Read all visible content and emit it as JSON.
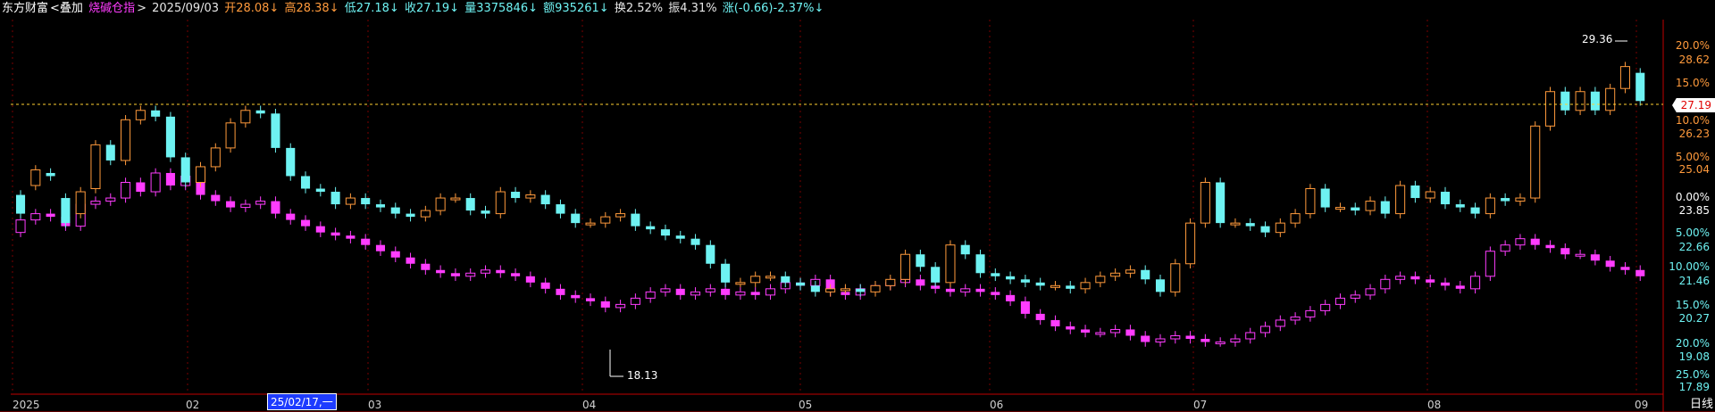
{
  "header": {
    "stock": "东方财富",
    "overlay_label": "<叠加",
    "overlay_name": "烧碱仓指",
    "arrow": ">",
    "date": "2025/09/03",
    "open": "开28.08↓",
    "high": "高28.38↓",
    "low": "低27.18↓",
    "close": "收27.19↓",
    "volume": "量3375846↓",
    "amount": "额935261↓",
    "turnover": "换2.52%",
    "amplitude": "振4.31%",
    "change": "涨(-0.66)-2.37%↓"
  },
  "right_axis": [
    {
      "text": "20.0%",
      "color": "#ff9a3c"
    },
    {
      "text": "28.62",
      "color": "#ff9a3c"
    },
    {
      "text": "15.0%",
      "color": "#ff9a3c"
    },
    {
      "text": "10.0%",
      "color": "#ff9a3c"
    },
    {
      "text": "26.23",
      "color": "#ff9a3c"
    },
    {
      "text": "5.00%",
      "color": "#ff9a3c"
    },
    {
      "text": "25.04",
      "color": "#ff9a3c"
    },
    {
      "text": "0.00%",
      "color": "#ffffff"
    },
    {
      "text": "23.85",
      "color": "#ffffff"
    },
    {
      "text": "5.00%",
      "color": "#6ef2f2"
    },
    {
      "text": "22.66",
      "color": "#6ef2f2"
    },
    {
      "text": "10.00%",
      "color": "#6ef2f2"
    },
    {
      "text": "21.46",
      "color": "#6ef2f2"
    },
    {
      "text": "15.0%",
      "color": "#6ef2f2"
    },
    {
      "text": "20.27",
      "color": "#6ef2f2"
    },
    {
      "text": "20.0%",
      "color": "#6ef2f2"
    },
    {
      "text": "19.08",
      "color": "#6ef2f2"
    },
    {
      "text": "25.0%",
      "color": "#6ef2f2"
    },
    {
      "text": "17.89",
      "color": "#6ef2f2"
    }
  ],
  "last_price": "27.19",
  "annotations": {
    "high_label": "29.36",
    "low_label": "18.13"
  },
  "months": [
    "2025",
    "02",
    "03",
    "04",
    "05",
    "06",
    "07",
    "08",
    "09"
  ],
  "cursor_date": "25/02/17,一",
  "period": "日线",
  "colors": {
    "up": "#ff3cff",
    "down": "#6ef2f2",
    "overlay_up": "#ff9a3c",
    "grid": "#7a0000",
    "axis": "#c00000"
  },
  "chart_data": {
    "type": "candlestick",
    "y_range": [
      17.89,
      29.8
    ],
    "series": [
      {
        "name": "东方财富",
        "role": "main",
        "closes": [
          23.6,
          25.0,
          24.8,
          23.3,
          24.3,
          25.8,
          25.3,
          26.6,
          26.9,
          26.7,
          25.4,
          24.6,
          25.1,
          25.7,
          26.5,
          26.9,
          26.8,
          25.7,
          24.8,
          24.4,
          24.3,
          23.9,
          24.1,
          23.9,
          23.8,
          23.6,
          23.5,
          23.7,
          24.1,
          24.1,
          23.7,
          23.6,
          24.3,
          24.1,
          24.2,
          23.9,
          23.6,
          23.3,
          23.3,
          23.5,
          23.6,
          23.2,
          23.1,
          22.9,
          22.8,
          22.6,
          22.0,
          21.4,
          21.4,
          21.6,
          21.6,
          21.4,
          21.3,
          21.1,
          21.2,
          21.2,
          21.1,
          21.3,
          21.5,
          22.3,
          21.9,
          21.4,
          22.6,
          22.3,
          21.7,
          21.6,
          21.5,
          21.4,
          21.3,
          21.3,
          21.2,
          21.4,
          21.6,
          21.7,
          21.8,
          21.5,
          21.1,
          22.0,
          23.3,
          24.6,
          23.3,
          23.3,
          23.2,
          23.0,
          23.3,
          23.6,
          24.4,
          23.8,
          23.8,
          23.7,
          24.0,
          23.6,
          24.5,
          24.1,
          24.3,
          23.9,
          23.8,
          23.6,
          24.1,
          24.0,
          24.1,
          26.4,
          27.5,
          26.9,
          27.5,
          26.9,
          27.6,
          28.3,
          27.2
        ],
        "opens": [
          24.2,
          24.5,
          24.9,
          24.1,
          23.6,
          24.4,
          25.8,
          25.3,
          26.6,
          26.9,
          26.7,
          25.4,
          24.6,
          25.1,
          25.7,
          26.5,
          26.9,
          26.8,
          25.7,
          24.8,
          24.4,
          24.3,
          23.9,
          24.1,
          23.9,
          23.8,
          23.6,
          23.5,
          23.7,
          24.1,
          24.1,
          23.7,
          23.6,
          24.3,
          24.1,
          24.2,
          23.9,
          23.6,
          23.3,
          23.3,
          23.5,
          23.6,
          23.2,
          23.1,
          22.9,
          22.8,
          22.6,
          22.0,
          21.4,
          21.4,
          21.6,
          21.6,
          21.4,
          21.3,
          21.1,
          21.2,
          21.2,
          21.1,
          21.3,
          21.5,
          22.3,
          21.9,
          21.4,
          22.6,
          22.3,
          21.7,
          21.6,
          21.5,
          21.4,
          21.3,
          21.3,
          21.2,
          21.4,
          21.6,
          21.7,
          21.8,
          21.5,
          21.1,
          22.0,
          23.3,
          24.6,
          23.3,
          23.3,
          23.2,
          23.0,
          23.3,
          23.6,
          24.4,
          23.8,
          23.8,
          23.7,
          24.0,
          23.6,
          24.5,
          24.1,
          24.3,
          23.9,
          23.8,
          23.6,
          24.1,
          24.0,
          24.1,
          26.4,
          27.5,
          26.9,
          27.5,
          26.9,
          27.6,
          28.1
        ]
      },
      {
        "name": "烧碱仓指",
        "role": "overlay",
        "closes": [
          23.4,
          23.6,
          23.5,
          23.2,
          23.9,
          24.0,
          24.1,
          24.6,
          24.3,
          24.9,
          24.5,
          24.8,
          24.2,
          24.0,
          23.8,
          23.9,
          24.0,
          23.6,
          23.4,
          23.2,
          23.0,
          22.9,
          22.8,
          22.6,
          22.4,
          22.2,
          22.0,
          21.8,
          21.7,
          21.6,
          21.7,
          21.8,
          21.7,
          21.6,
          21.4,
          21.2,
          21.0,
          20.9,
          20.8,
          20.6,
          20.7,
          20.9,
          21.1,
          21.2,
          21.0,
          21.1,
          21.2,
          21.0,
          21.1,
          21.0,
          21.2,
          21.4,
          21.3,
          21.5,
          21.1,
          21.0,
          21.2,
          21.3,
          21.4,
          21.5,
          21.3,
          21.2,
          21.1,
          21.2,
          21.1,
          21.0,
          20.8,
          20.4,
          20.2,
          20.0,
          19.9,
          19.8,
          19.8,
          19.9,
          19.7,
          19.5,
          19.6,
          19.7,
          19.6,
          19.5,
          19.5,
          19.6,
          19.8,
          20.0,
          20.2,
          20.3,
          20.5,
          20.7,
          20.9,
          21.0,
          21.2,
          21.5,
          21.6,
          21.5,
          21.4,
          21.3,
          21.2,
          21.6,
          22.4,
          22.6,
          22.8,
          22.6,
          22.5,
          22.3,
          22.3,
          22.1,
          21.9,
          21.8,
          21.6
        ],
        "opens": [
          23.0,
          23.4,
          23.6,
          23.5,
          23.2,
          23.9,
          24.0,
          24.1,
          24.6,
          24.3,
          24.9,
          24.5,
          24.8,
          24.2,
          24.0,
          23.8,
          23.9,
          24.0,
          23.6,
          23.4,
          23.2,
          23.0,
          22.9,
          22.8,
          22.6,
          22.4,
          22.2,
          22.0,
          21.8,
          21.7,
          21.6,
          21.7,
          21.8,
          21.7,
          21.6,
          21.4,
          21.2,
          21.0,
          20.9,
          20.8,
          20.6,
          20.7,
          20.9,
          21.1,
          21.2,
          21.0,
          21.1,
          21.2,
          21.0,
          21.1,
          21.0,
          21.2,
          21.4,
          21.3,
          21.5,
          21.1,
          21.0,
          21.2,
          21.3,
          21.4,
          21.5,
          21.3,
          21.2,
          21.1,
          21.2,
          21.1,
          21.0,
          20.8,
          20.4,
          20.2,
          20.0,
          19.9,
          19.8,
          19.8,
          19.9,
          19.7,
          19.5,
          19.6,
          19.7,
          19.6,
          19.5,
          19.5,
          19.6,
          19.8,
          20.0,
          20.2,
          20.3,
          20.5,
          20.7,
          20.9,
          21.0,
          21.2,
          21.5,
          21.6,
          21.5,
          21.4,
          21.3,
          21.2,
          21.6,
          22.4,
          22.6,
          22.8,
          22.6,
          22.5,
          22.3,
          22.3,
          22.1,
          21.9,
          21.8
        ]
      }
    ]
  }
}
